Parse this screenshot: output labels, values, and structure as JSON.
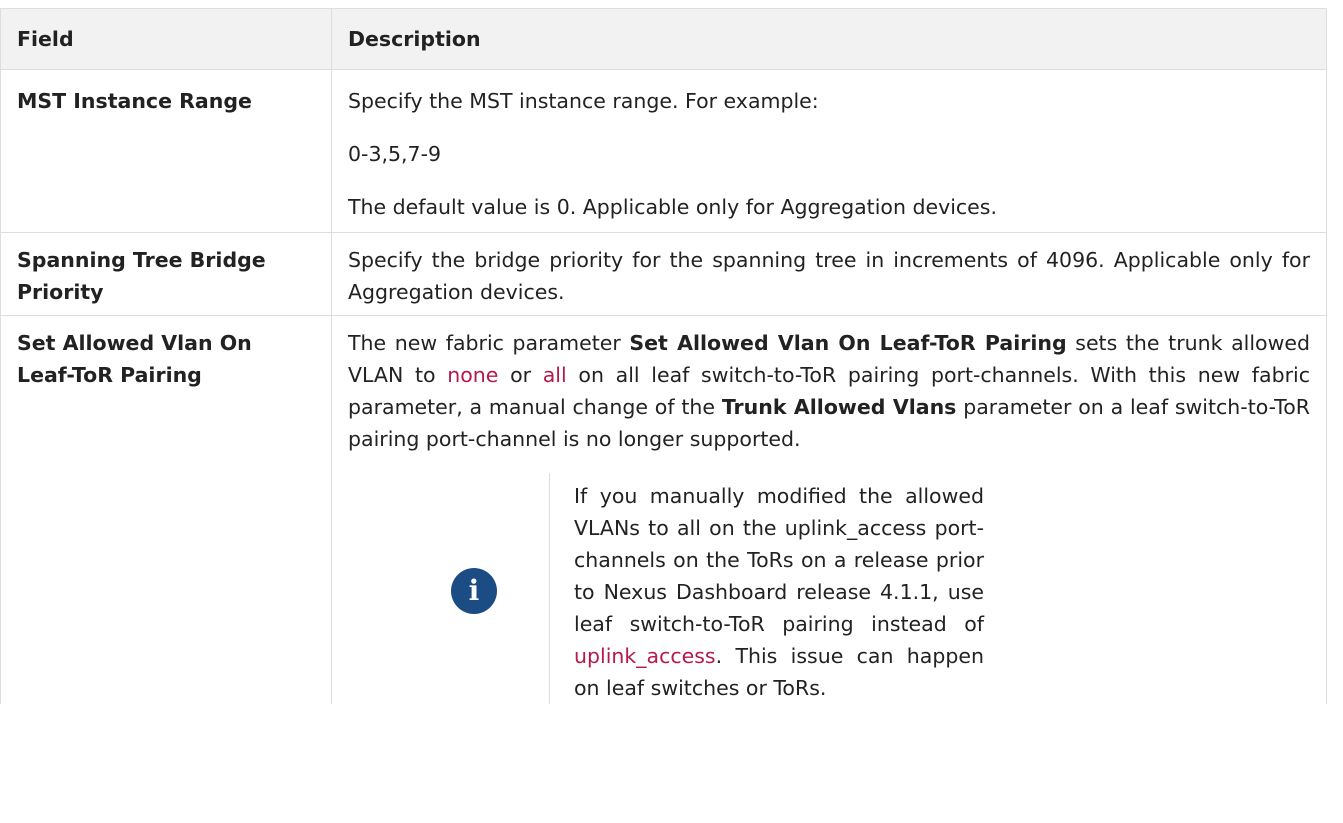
{
  "table": {
    "header": {
      "field": "Field",
      "description": "Description"
    },
    "rows": [
      {
        "field": "MST Instance Range",
        "desc": {
          "p1": "Specify the MST instance range. For example:",
          "p2": "0-3,5,7-9",
          "p3": "The default value is 0. Applicable only for Aggregation devices."
        }
      },
      {
        "field": "Spanning Tree Bridge Priority",
        "desc": {
          "p1": "Specify the bridge priority for the spanning tree in increments of 4096. Applicable only for Aggregation devices."
        }
      },
      {
        "field": "Set Allowed Vlan On Leaf-ToR Pairing",
        "desc": {
          "t1": "The new fabric parameter ",
          "b1": "Set Allowed Vlan On Leaf-ToR Pairing",
          "t2": " sets the trunk allowed VLAN to ",
          "l1": "none",
          "t3": " or ",
          "l2": "all",
          "t4": " on all leaf switch-to-ToR pairing port-channels. With this new fabric parameter, a manual change of the ",
          "b2": "Trunk Allowed Vlans",
          "t5": " parameter on a leaf switch-to-ToR pairing port-channel is no longer supported."
        },
        "note": {
          "icon": "info-icon",
          "icon_glyph": "i",
          "t1": "If you manually modified the allowed VLANs to all on the uplink_access port-channels on the ToRs on a release prior to Nexus Dashboard release 4.1.1, use leaf switch-to-ToR pairing instead of ",
          "l1": "uplink_access",
          "t2": ". This issue can happen on leaf switches or ToRs."
        }
      }
    ]
  },
  "colors": {
    "link": "#b51a4b",
    "info_icon": "#1b4c84",
    "header_bg": "#f2f2f2",
    "border": "#dedede"
  }
}
